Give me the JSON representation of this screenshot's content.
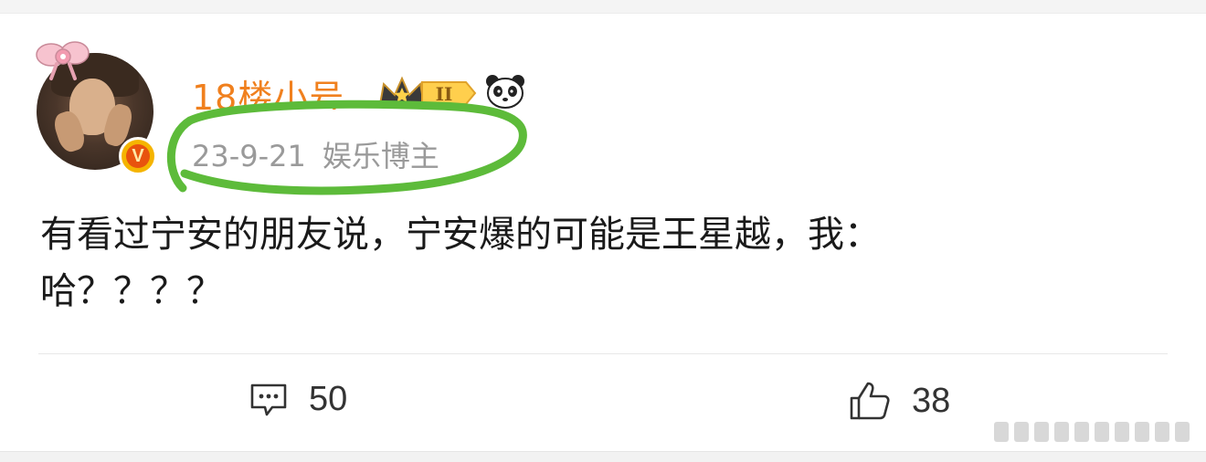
{
  "post": {
    "username": "18楼小号",
    "date": "23-9-21",
    "tag": "娱乐博主",
    "verified_letter": "V",
    "level_numeral": "II",
    "text_lines": [
      "有看过宁安的朋友说，宁安爆的可能是王星越，我：",
      "哈？？？？"
    ]
  },
  "actions": {
    "comments": {
      "icon": "comment-icon",
      "count": "50"
    },
    "likes": {
      "icon": "thumbs-up-icon",
      "count": "38"
    }
  },
  "colors": {
    "username": "#f0801e",
    "meta_text": "#9a9a9a",
    "highlight": "#5dbb3a",
    "verified_badge": "#e8530e"
  }
}
